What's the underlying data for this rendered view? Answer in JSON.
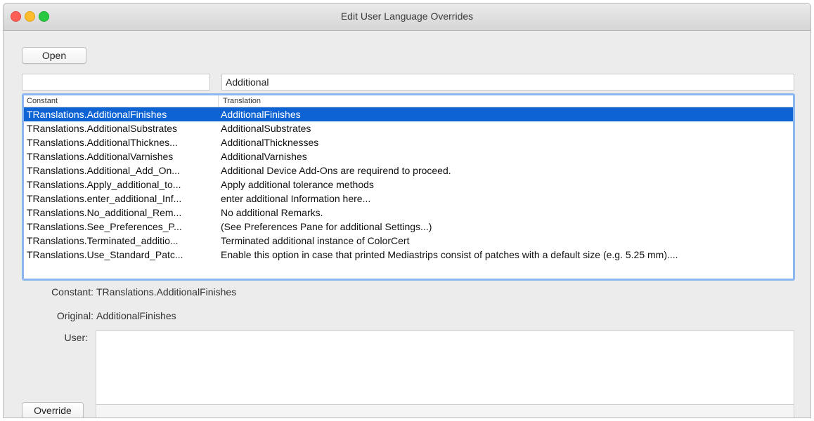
{
  "window": {
    "title": "Edit User Language Overrides"
  },
  "toolbar": {
    "open_label": "Open"
  },
  "filters": {
    "constant_value": "",
    "translation_value": "Additional"
  },
  "list": {
    "headers": {
      "constant": "Constant",
      "translation": "Translation"
    },
    "rows": [
      {
        "constant": "TRanslations.AdditionalFinishes",
        "translation": "AdditionalFinishes",
        "selected": true
      },
      {
        "constant": "TRanslations.AdditionalSubstrates",
        "translation": "AdditionalSubstrates",
        "selected": false
      },
      {
        "constant": "TRanslations.AdditionalThicknes...",
        "translation": "AdditionalThicknesses",
        "selected": false
      },
      {
        "constant": "TRanslations.AdditionalVarnishes",
        "translation": "AdditionalVarnishes",
        "selected": false
      },
      {
        "constant": "TRanslations.Additional_Add_On...",
        "translation": "Additional Device Add-Ons are requirend to proceed.",
        "selected": false
      },
      {
        "constant": "TRanslations.Apply_additional_to...",
        "translation": "Apply additional tolerance methods",
        "selected": false
      },
      {
        "constant": "TRanslations.enter_additional_Inf...",
        "translation": "enter additional Information here...",
        "selected": false
      },
      {
        "constant": "TRanslations.No_additional_Rem...",
        "translation": "No additional Remarks.",
        "selected": false
      },
      {
        "constant": "TRanslations.See_Preferences_P...",
        "translation": "(See Preferences Pane for additional Settings...)",
        "selected": false
      },
      {
        "constant": "TRanslations.Terminated_additio...",
        "translation": "Terminated additional instance of ColorCert",
        "selected": false
      },
      {
        "constant": "TRanslations.Use_Standard_Patc...",
        "translation": "Enable this option in case that printed Mediastrips consist of patches with a default size (e.g. 5.25 mm)....",
        "selected": false
      }
    ]
  },
  "details": {
    "constant_label": "Constant:",
    "constant_value": "TRanslations.AdditionalFinishes",
    "original_label": "Original:",
    "original_value": "AdditionalFinishes",
    "user_label": "User:",
    "user_value": ""
  },
  "actions": {
    "override_label": "Override"
  },
  "colors": {
    "selection": "#0d63d4",
    "focus_ring": "#8cb6ee",
    "window_bg": "#ececec"
  }
}
